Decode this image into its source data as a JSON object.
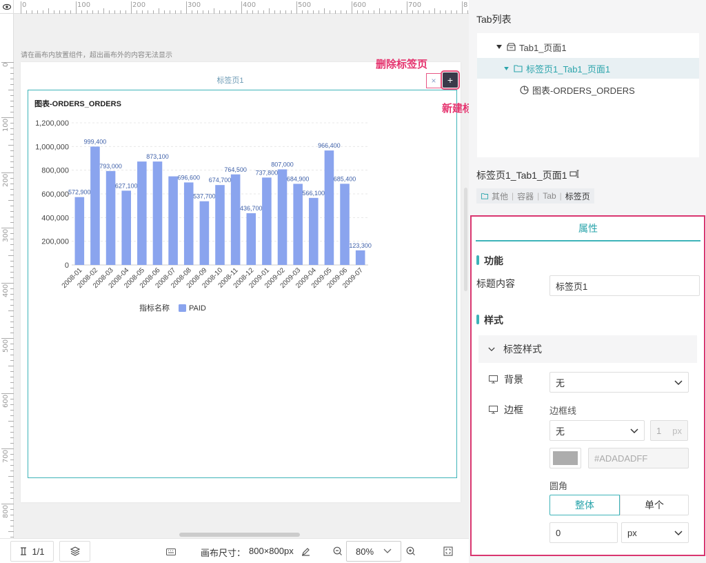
{
  "canvas": {
    "hint": "请在画布内放置组件，超出画布外的内容无法显示",
    "ruler_x": [
      "0",
      "100",
      "200",
      "300",
      "400",
      "500",
      "600",
      "700",
      "8"
    ],
    "ruler_y": [
      "0",
      "100",
      "200",
      "300",
      "400",
      "500",
      "600",
      "700",
      "800"
    ],
    "tab_label": "标签页1",
    "tab_close_glyph": "×",
    "tab_add_glyph": "+",
    "annotation_delete": "删除标签页",
    "annotation_new": "新建标签页",
    "chart_title": "图表-ORDERS_ORDERS"
  },
  "chart_data": {
    "type": "bar",
    "title": "图表-ORDERS_ORDERS",
    "categories": [
      "2008-01",
      "2008-02",
      "2008-03",
      "2008-04",
      "2008-05",
      "2008-06",
      "2008-07",
      "2008-08",
      "2008-09",
      "2008-10",
      "2008-11",
      "2008-12",
      "2009-01",
      "2009-02",
      "2009-03",
      "2009-04",
      "2009-05",
      "2009-06",
      "2009-07"
    ],
    "series": [
      {
        "name": "PAID",
        "values": [
          572900,
          999400,
          793000,
          627100,
          873100,
          873100,
          748000,
          696600,
          537700,
          674700,
          764500,
          436700,
          737800,
          807000,
          684900,
          566100,
          966400,
          685400,
          123300
        ]
      }
    ],
    "value_labels": [
      "572,900",
      "999,400",
      "793,000",
      "627,100",
      "",
      "873,100",
      "",
      "696,600",
      "537,700",
      "674,700",
      "764,500",
      "436,700",
      "737,800",
      "807,000",
      "684,900",
      "566,100",
      "966,400",
      "685,400",
      "123,300"
    ],
    "y_ticks": [
      "0",
      "200,000",
      "400,000",
      "600,000",
      "800,000",
      "1,000,000",
      "1,200,000"
    ],
    "ylim": [
      0,
      1200000
    ],
    "legend_title": "指标名称",
    "legend_item": "PAID",
    "color": "#8aa4ee",
    "grid": true
  },
  "bottom": {
    "page_indicator": "1/1",
    "canvas_size_label": "画布尺寸：",
    "canvas_size": "800×800px",
    "zoom": "80%"
  },
  "panel": {
    "tab_list_title": "Tab列表",
    "tree": [
      "Tab1_页面1",
      "标签页1_Tab1_页面1",
      "图表-ORDERS_ORDERS"
    ],
    "selected_name": "标签页1_Tab1_页面1",
    "breadcrumb": [
      "其他",
      "容器",
      "Tab",
      "标签页"
    ],
    "props_tab": "属性",
    "section_function": "功能",
    "title_content_label": "标题内容",
    "title_content_value": "标签页1",
    "section_style": "样式",
    "tab_style_title": "标签样式",
    "background_label": "背景",
    "background_value": "无",
    "border_label": "边框",
    "border_line_label": "边框线",
    "border_line_value": "无",
    "border_width": "1",
    "border_unit": "px",
    "border_color_hex": "#ADADADFF",
    "border_color": "#ADADAD",
    "radius_label": "圆角",
    "radius_whole": "整体",
    "radius_single": "单个",
    "radius_value": "0",
    "radius_unit": "px",
    "accent": "#3db3b8"
  }
}
